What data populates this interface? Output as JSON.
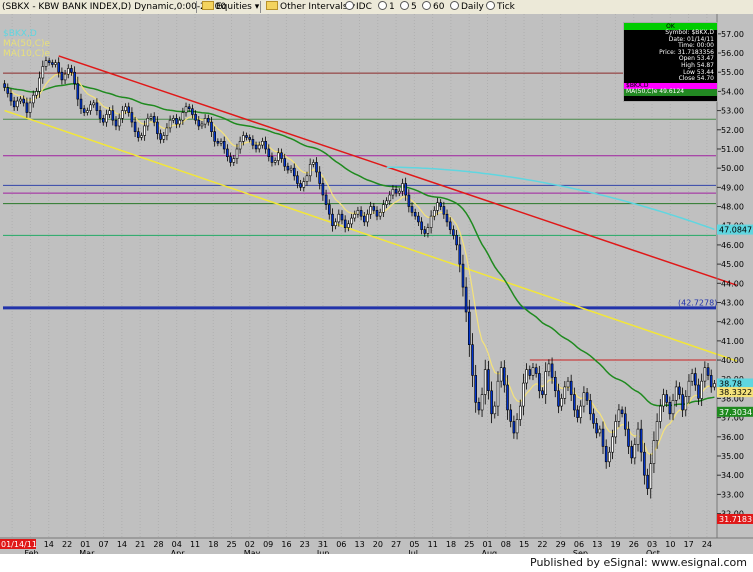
{
  "toolbar": {
    "items": [
      "(SBKX - KBW BANK INDEX,D) Dynamic,0:00-24:00",
      "Equities",
      "Other Intervals",
      "IDC",
      "1",
      "5",
      "60",
      "Daily",
      "Tick"
    ]
  },
  "legend": {
    "symbol": "$BKX,D",
    "ma50": "MA(50,C)e",
    "ma10": "MA(10,C)e"
  },
  "info_box": {
    "status": "OK",
    "rows": [
      "Symbol: $BKX,D",
      "Date: 01/14/11",
      "Time: 00:00",
      "Price: 31.7183356",
      "Open 53.47",
      "High 54.87",
      "Low 53.44",
      "Close 54.70"
    ],
    "ma_rows": [
      "$BKX,D",
      "MA(50,C)e 49.6124"
    ]
  },
  "footer": {
    "text": "Published by eSignal: www.esignal.com"
  },
  "colors": {
    "background": "#c0c0c0",
    "candle_fill": "#0033cc",
    "ma10": "#f4e27a",
    "ma50": "#1f8a1f",
    "ma200": "#5fd6e0",
    "downtrend": "#e01818",
    "channel": "#f2e63a",
    "resistance": "#e01818",
    "level_4272": "#2233aa"
  },
  "chart_data": {
    "type": "candlestick",
    "symbol": "$BKX",
    "timeframe": "Daily",
    "ylim": [
      31.3,
      57.2
    ],
    "y_ticks": [
      "57.00",
      "56.00",
      "55.00",
      "54.00",
      "53.00",
      "52.00",
      "51.00",
      "50.00",
      "49.00",
      "48.00",
      "47.00",
      "46.00",
      "45.00",
      "44.00",
      "43.00",
      "42.00",
      "41.00",
      "40.00",
      "39.00",
      "38.00",
      "37.00",
      "36.00",
      "35.00",
      "34.00",
      "33.00",
      "32.00"
    ],
    "date_ticks": [
      "31",
      "07",
      "14",
      "22",
      "01",
      "07",
      "14",
      "21",
      "28",
      "04",
      "11",
      "18",
      "25",
      "02",
      "09",
      "16",
      "23",
      "31",
      "06",
      "13",
      "20",
      "27",
      "05",
      "11",
      "18",
      "25",
      "01",
      "08",
      "15",
      "22",
      "29",
      "06",
      "13",
      "19",
      "26",
      "03",
      "10",
      "17",
      "24"
    ],
    "month_labels": [
      "Feb",
      "Mar",
      "Apr",
      "May",
      "Jun",
      "Jul",
      "Aug",
      "Sep",
      "Oct"
    ],
    "date_start_label": "01/14/11",
    "price_labels": [
      {
        "text": "47.0847",
        "value": 46.8,
        "color": "#5fd6e0"
      },
      {
        "text": "(42.7278)",
        "value": 42.7278,
        "color": "#2233aa"
      },
      {
        "text": "38.78",
        "value": 38.78,
        "color": "#5fd6e0"
      },
      {
        "text": "38.3322",
        "value": 38.33,
        "color": "#f4e27a"
      },
      {
        "text": "37.3034",
        "value": 37.3034,
        "color": "#1f8a1f"
      },
      {
        "text": "31.7183",
        "value": 31.7183,
        "color": "#e01818"
      }
    ],
    "horizontal_levels": [
      {
        "value": 54.95,
        "color": "#8b2b2b"
      },
      {
        "value": 52.55,
        "color": "#4a8a4a"
      },
      {
        "value": 50.65,
        "color": "#a020a0"
      },
      {
        "value": 49.1,
        "color": "#3344aa"
      },
      {
        "value": 48.7,
        "color": "#a020a0"
      },
      {
        "value": 48.15,
        "color": "#2a7a2a"
      },
      {
        "value": 46.5,
        "color": "#22aa66"
      },
      {
        "value": 42.72,
        "color": "#2233aa"
      },
      {
        "value": 40.0,
        "color": "#cc2222",
        "from_index": 165
      }
    ],
    "trend_lines": [
      {
        "name": "downtrend",
        "from": [
          17,
          55.85
        ],
        "to": [
          230,
          43.9
        ]
      },
      {
        "name": "channel",
        "from": [
          0,
          53.0
        ],
        "to": [
          230,
          39.95
        ]
      }
    ],
    "closes": [
      54.2,
      53.9,
      53.5,
      53.2,
      53.5,
      53.6,
      53.4,
      52.9,
      53.4,
      53.8,
      54.0,
      54.7,
      55.3,
      55.6,
      55.5,
      55.4,
      55.5,
      55.0,
      54.6,
      54.9,
      55.2,
      55.0,
      54.4,
      53.6,
      53.1,
      52.9,
      53.0,
      53.3,
      53.4,
      53.0,
      52.6,
      52.4,
      52.8,
      53.0,
      52.5,
      52.2,
      52.6,
      53.0,
      53.2,
      52.9,
      52.4,
      51.9,
      51.6,
      51.7,
      52.2,
      52.6,
      52.7,
      52.4,
      51.8,
      51.5,
      51.7,
      52.1,
      52.5,
      52.6,
      52.3,
      52.5,
      52.9,
      53.2,
      53.1,
      52.8,
      52.5,
      52.2,
      52.3,
      52.6,
      52.4,
      51.9,
      51.4,
      51.3,
      51.4,
      51.0,
      50.6,
      50.3,
      50.5,
      51.0,
      51.4,
      51.7,
      51.6,
      51.5,
      51.2,
      51.0,
      51.2,
      51.4,
      51.0,
      50.6,
      50.3,
      50.4,
      50.8,
      50.5,
      50.1,
      49.9,
      50.0,
      49.6,
      49.2,
      49.0,
      49.3,
      49.6,
      50.2,
      50.3,
      49.8,
      49.2,
      48.6,
      48.1,
      47.6,
      47.0,
      47.2,
      47.6,
      47.3,
      46.9,
      47.1,
      47.4,
      47.6,
      47.8,
      47.5,
      47.2,
      47.6,
      48.0,
      47.8,
      47.5,
      47.7,
      48.1,
      48.3,
      48.6,
      48.9,
      48.7,
      48.8,
      49.2,
      48.6,
      48.0,
      47.7,
      47.5,
      47.2,
      46.8,
      46.6,
      46.9,
      47.5,
      47.8,
      48.2,
      48.0,
      47.6,
      47.2,
      46.8,
      46.5,
      46.0,
      45.0,
      43.8,
      42.5,
      40.8,
      39.2,
      37.8,
      37.4,
      38.2,
      39.5,
      38.4,
      37.2,
      37.6,
      38.9,
      39.6,
      38.7,
      37.4,
      36.8,
      36.2,
      36.9,
      37.6,
      38.8,
      39.5,
      39.2,
      39.6,
      39.3,
      38.4,
      38.2,
      39.4,
      39.8,
      39.1,
      38.4,
      37.6,
      38.0,
      38.6,
      38.9,
      38.2,
      37.4,
      37.0,
      37.6,
      38.3,
      37.9,
      37.2,
      36.7,
      36.2,
      36.4,
      35.5,
      34.7,
      35.2,
      36.0,
      36.8,
      37.4,
      37.2,
      36.4,
      35.5,
      34.9,
      35.6,
      36.4,
      35.2,
      34.0,
      33.3,
      34.6,
      35.8,
      36.8,
      37.6,
      38.2,
      37.8,
      37.2,
      37.9,
      38.6,
      38.2,
      37.4,
      38.1,
      38.9,
      39.3,
      38.7,
      38.0,
      38.9,
      39.6,
      39.2,
      38.6,
      38.78
    ]
  }
}
